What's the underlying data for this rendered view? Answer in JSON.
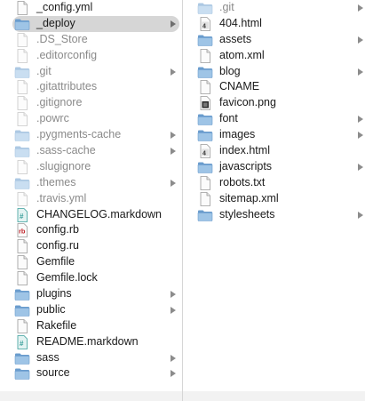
{
  "left_column": {
    "items": [
      {
        "name": "_config.yml",
        "kind": "file-blank",
        "dim": false,
        "folder": false,
        "selected": false
      },
      {
        "name": "_deploy",
        "kind": "folder",
        "dim": false,
        "folder": true,
        "selected": true
      },
      {
        "name": ".DS_Store",
        "kind": "file-blank",
        "dim": true,
        "folder": false,
        "selected": false
      },
      {
        "name": ".editorconfig",
        "kind": "file-blank",
        "dim": true,
        "folder": false,
        "selected": false
      },
      {
        "name": ".git",
        "kind": "folder",
        "dim": true,
        "folder": true,
        "selected": false
      },
      {
        "name": ".gitattributes",
        "kind": "file-blank",
        "dim": true,
        "folder": false,
        "selected": false
      },
      {
        "name": ".gitignore",
        "kind": "file-blank",
        "dim": true,
        "folder": false,
        "selected": false
      },
      {
        "name": ".powrc",
        "kind": "file-blank",
        "dim": true,
        "folder": false,
        "selected": false
      },
      {
        "name": ".pygments-cache",
        "kind": "folder",
        "dim": true,
        "folder": true,
        "selected": false
      },
      {
        "name": ".sass-cache",
        "kind": "folder",
        "dim": true,
        "folder": true,
        "selected": false
      },
      {
        "name": ".slugignore",
        "kind": "file-blank",
        "dim": true,
        "folder": false,
        "selected": false
      },
      {
        "name": ".themes",
        "kind": "folder",
        "dim": true,
        "folder": true,
        "selected": false
      },
      {
        "name": ".travis.yml",
        "kind": "file-blank",
        "dim": true,
        "folder": false,
        "selected": false
      },
      {
        "name": "CHANGELOG.markdown",
        "kind": "file-markdown",
        "dim": false,
        "folder": false,
        "selected": false
      },
      {
        "name": "config.rb",
        "kind": "file-ruby",
        "dim": false,
        "folder": false,
        "selected": false
      },
      {
        "name": "config.ru",
        "kind": "file-blank",
        "dim": false,
        "folder": false,
        "selected": false
      },
      {
        "name": "Gemfile",
        "kind": "file-blank",
        "dim": false,
        "folder": false,
        "selected": false
      },
      {
        "name": "Gemfile.lock",
        "kind": "file-blank",
        "dim": false,
        "folder": false,
        "selected": false
      },
      {
        "name": "plugins",
        "kind": "folder",
        "dim": false,
        "folder": true,
        "selected": false
      },
      {
        "name": "public",
        "kind": "folder",
        "dim": false,
        "folder": true,
        "selected": false
      },
      {
        "name": "Rakefile",
        "kind": "file-blank",
        "dim": false,
        "folder": false,
        "selected": false
      },
      {
        "name": "README.markdown",
        "kind": "file-markdown",
        "dim": false,
        "folder": false,
        "selected": false
      },
      {
        "name": "sass",
        "kind": "folder",
        "dim": false,
        "folder": true,
        "selected": false
      },
      {
        "name": "source",
        "kind": "folder",
        "dim": false,
        "folder": true,
        "selected": false
      }
    ]
  },
  "right_column": {
    "items": [
      {
        "name": ".git",
        "kind": "folder",
        "dim": true,
        "folder": true,
        "selected": false
      },
      {
        "name": "404.html",
        "kind": "file-html",
        "dim": false,
        "folder": false,
        "selected": false
      },
      {
        "name": "assets",
        "kind": "folder",
        "dim": false,
        "folder": true,
        "selected": false
      },
      {
        "name": "atom.xml",
        "kind": "file-blank",
        "dim": false,
        "folder": false,
        "selected": false
      },
      {
        "name": "blog",
        "kind": "folder",
        "dim": false,
        "folder": true,
        "selected": false
      },
      {
        "name": "CNAME",
        "kind": "file-blank",
        "dim": false,
        "folder": false,
        "selected": false
      },
      {
        "name": "favicon.png",
        "kind": "file-image",
        "dim": false,
        "folder": false,
        "selected": false
      },
      {
        "name": "font",
        "kind": "folder",
        "dim": false,
        "folder": true,
        "selected": false
      },
      {
        "name": "images",
        "kind": "folder",
        "dim": false,
        "folder": true,
        "selected": false
      },
      {
        "name": "index.html",
        "kind": "file-html",
        "dim": false,
        "folder": false,
        "selected": false
      },
      {
        "name": "javascripts",
        "kind": "folder",
        "dim": false,
        "folder": true,
        "selected": false
      },
      {
        "name": "robots.txt",
        "kind": "file-blank",
        "dim": false,
        "folder": false,
        "selected": false
      },
      {
        "name": "sitemap.xml",
        "kind": "file-blank",
        "dim": false,
        "folder": false,
        "selected": false
      },
      {
        "name": "stylesheets",
        "kind": "folder",
        "dim": false,
        "folder": true,
        "selected": false
      }
    ]
  },
  "colors": {
    "selection": "#d6d6d6",
    "folder": "#8fb8de",
    "folder_dark": "#6a9ccd",
    "dim_text": "#8a8a8a",
    "ruby_red": "#c0262c",
    "markdown_teal": "#3a9e9a"
  }
}
